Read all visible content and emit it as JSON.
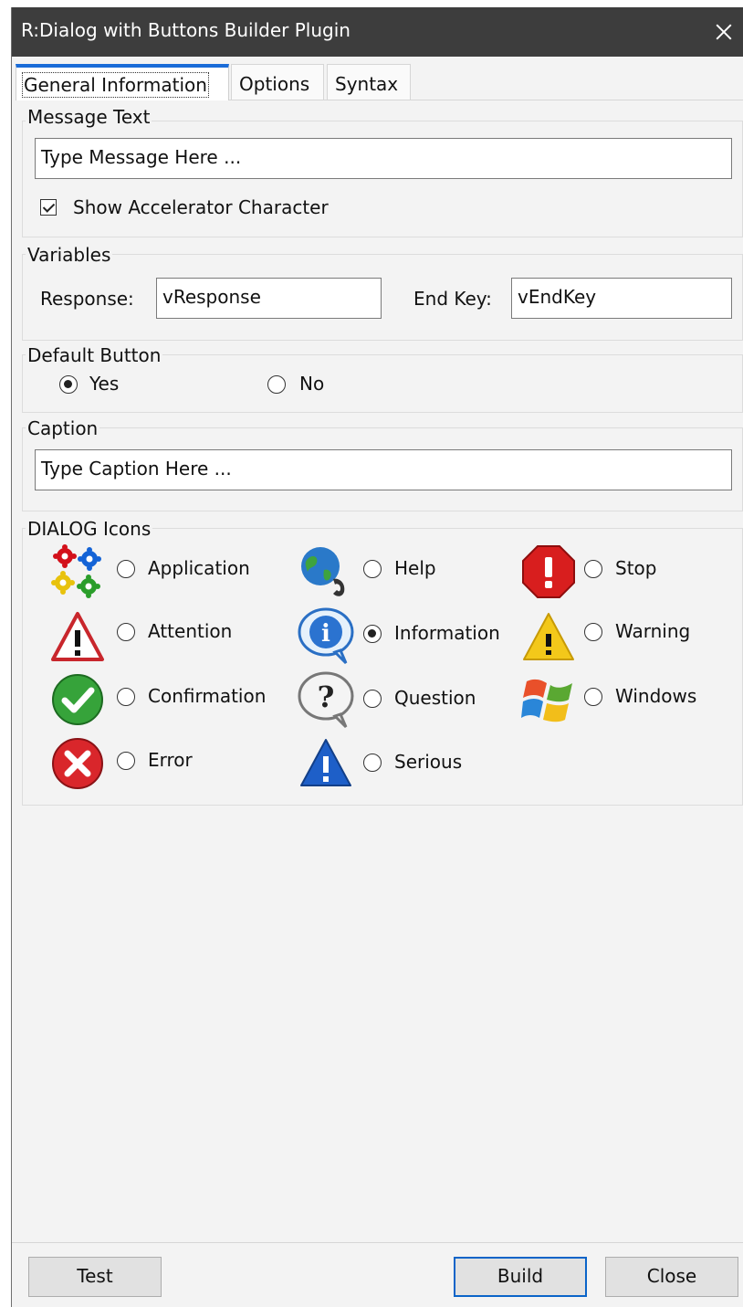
{
  "window": {
    "title": "R:Dialog with Buttons Builder Plugin"
  },
  "tabs": [
    {
      "label": "General Information",
      "active": true
    },
    {
      "label": "Options",
      "active": false
    },
    {
      "label": "Syntax",
      "active": false
    }
  ],
  "message_text": {
    "group_label": "Message Text",
    "value": "Type Message Here ...",
    "accelerator_label": "Show Accelerator Character",
    "accelerator_checked": true
  },
  "variables": {
    "group_label": "Variables",
    "response_label": "Response:",
    "response_value": "vResponse",
    "endkey_label": "End Key:",
    "endkey_value": "vEndKey"
  },
  "default_button": {
    "group_label": "Default Button",
    "options": [
      "Yes",
      "No"
    ],
    "selected": "Yes"
  },
  "caption": {
    "group_label": "Caption",
    "value": "Type Caption Here ..."
  },
  "dialog_icons": {
    "group_label": "DIALOG Icons",
    "items": [
      {
        "label": "Application",
        "icon": "gears-icon"
      },
      {
        "label": "Help",
        "icon": "globe-phone-icon"
      },
      {
        "label": "Stop",
        "icon": "stop-octagon-icon"
      },
      {
        "label": "Attention",
        "icon": "attention-triangle-icon"
      },
      {
        "label": "Information",
        "icon": "info-bubble-icon"
      },
      {
        "label": "Warning",
        "icon": "warning-triangle-icon"
      },
      {
        "label": "Confirmation",
        "icon": "check-circle-icon"
      },
      {
        "label": "Question",
        "icon": "question-bubble-icon"
      },
      {
        "label": "Windows",
        "icon": "windows-logo-icon"
      },
      {
        "label": "Error",
        "icon": "error-circle-icon"
      },
      {
        "label": "Serious",
        "icon": "serious-triangle-icon"
      }
    ],
    "selected": "Information"
  },
  "buttons": {
    "test": "Test",
    "build": "Build",
    "close": "Close"
  },
  "colors": {
    "titlebar": "#3d3d3d",
    "accent": "#1a6cd8",
    "background": "#f3f3f3"
  }
}
